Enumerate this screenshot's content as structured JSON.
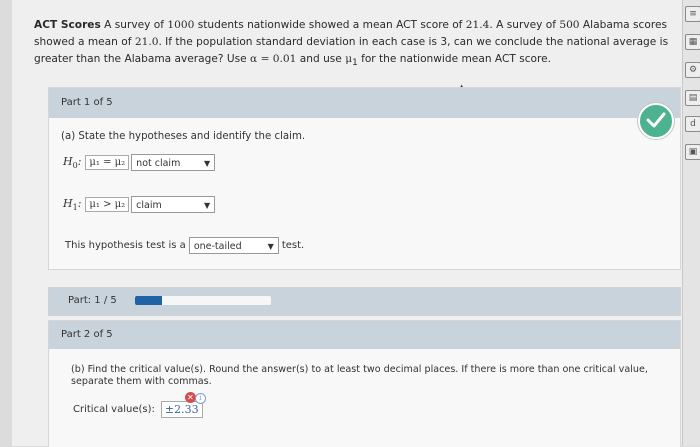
{
  "problem": {
    "title": "ACT Scores",
    "t1": " A survey of ",
    "n_national": "1000",
    "t2": " students nationwide showed a mean ACT score of ",
    "mean_national": "21.4",
    "t3": ". A survey of ",
    "n_alabama": "500",
    "t4": " Alabama scores showed a mean of ",
    "mean_alabama": "21.0",
    "t5": ". If the population standard deviation in each case is 3, can we conclude the national average is greater than the Alabama average? Use ",
    "alpha_expr": "α = 0.01",
    "t6": " and use ",
    "mu1": "μ",
    "mu1_sub": "1",
    "t7": " for the nationwide mean ACT score."
  },
  "part1": {
    "header": "Part 1 of 5",
    "question": "(a) State the hypotheses and identify the claim.",
    "h0": {
      "symbol": "H",
      "sub": "0",
      "expr": "μ₁ = μ₂",
      "claim_value": "not claim"
    },
    "h1": {
      "symbol": "H",
      "sub": "1",
      "expr": "μ₁ > μ₂",
      "claim_value": "claim"
    },
    "test_prefix": "This hypothesis test is a",
    "test_value": "one-tailed",
    "test_suffix": "test.",
    "status_icon": "check-icon"
  },
  "progress": {
    "label": "Part: 1 / 5",
    "fraction": 0.2,
    "fill_color": "#1e63a6"
  },
  "part2": {
    "header": "Part 2 of 5",
    "question": "(b) Find the critical value(s). Round the answer(s) to at least two decimal places. If there is more than one critical value, separate them with commas.",
    "critical_label": "Critical value(s):",
    "answer": "±2.33"
  },
  "colors": {
    "header_bg": "#c9d3dc",
    "check_green": "#4db28f",
    "error_red": "#d74b4b"
  }
}
